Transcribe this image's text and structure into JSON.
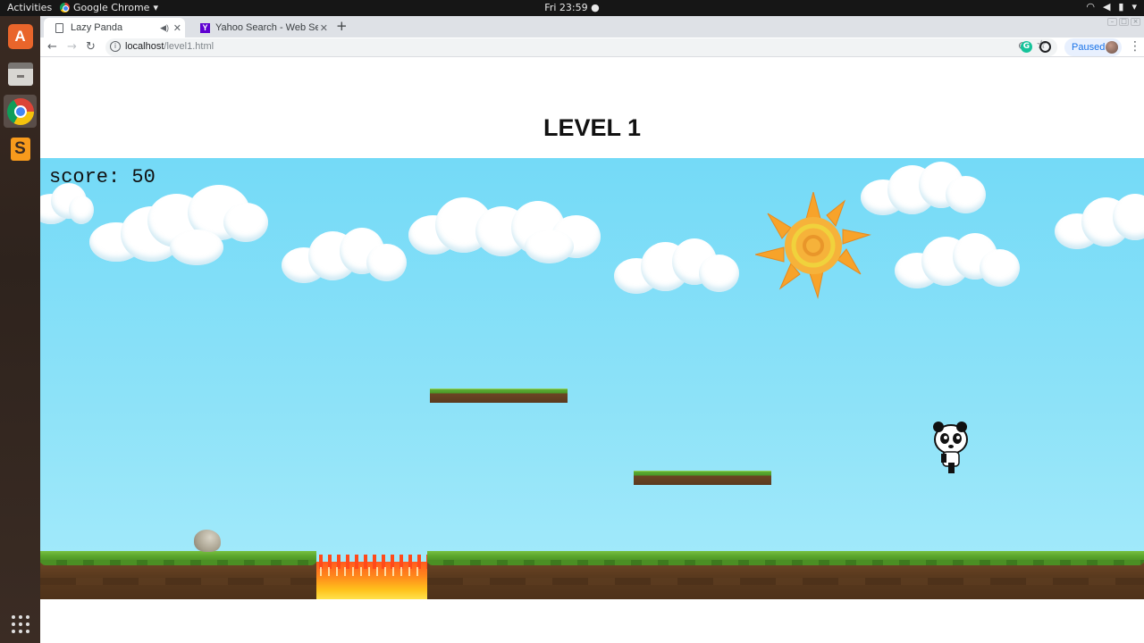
{
  "topbar": {
    "activities": "Activities",
    "app_name": "Google Chrome",
    "app_menu_arrow": "▾",
    "clock": "Fri 23:59 ●",
    "tray_icons": [
      "wifi-icon",
      "volume-icon",
      "battery-icon",
      "power-icon"
    ]
  },
  "dock": {
    "items": [
      "ubuntu-software",
      "files",
      "google-chrome",
      "sublime-text",
      "show-applications"
    ]
  },
  "browser": {
    "tabs": [
      {
        "title": "Lazy Panda",
        "active": true
      },
      {
        "title": "Yahoo Search - Web Search",
        "active": false
      }
    ],
    "new_tab": "+",
    "url_host": "localhost",
    "url_path": "/level1.html",
    "profile_label": "Paused",
    "ext_grammarly": "G"
  },
  "page": {
    "title": "LEVEL 1"
  },
  "game": {
    "score_text": "score: 50",
    "sky_color": "#74daf7",
    "sprites": [
      "cloud",
      "sun",
      "grass-platform",
      "grass-platform",
      "panda-player",
      "rock",
      "fire-pit",
      "ground"
    ]
  }
}
